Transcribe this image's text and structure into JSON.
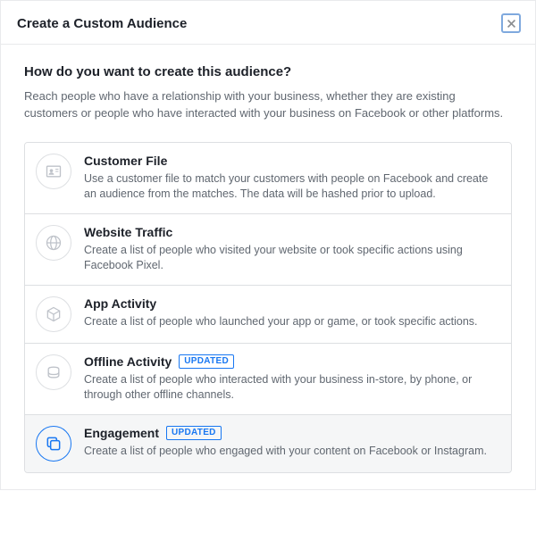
{
  "dialog": {
    "title": "Create a Custom Audience",
    "question": "How do you want to create this audience?",
    "description": "Reach people who have a relationship with your business, whether they are existing customers or people who have interacted with your business on Facebook or other platforms.",
    "badge_label": "UPDATED"
  },
  "options": {
    "customer_file": {
      "title": "Customer File",
      "desc": "Use a customer file to match your customers with people on Facebook and create an audience from the matches. The data will be hashed prior to upload."
    },
    "website_traffic": {
      "title": "Website Traffic",
      "desc": "Create a list of people who visited your website or took specific actions using Facebook Pixel."
    },
    "app_activity": {
      "title": "App Activity",
      "desc": "Create a list of people who launched your app or game, or took specific actions."
    },
    "offline_activity": {
      "title": "Offline Activity",
      "desc": "Create a list of people who interacted with your business in-store, by phone, or through other offline channels."
    },
    "engagement": {
      "title": "Engagement",
      "desc": "Create a list of people who engaged with your content on Facebook or Instagram."
    }
  }
}
